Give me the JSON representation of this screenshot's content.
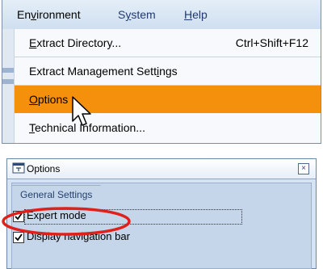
{
  "menubar": {
    "items": [
      {
        "pre": "En",
        "u": "v",
        "post": "ironment"
      },
      {
        "pre": "S",
        "u": "y",
        "post": "stem"
      },
      {
        "pre": "",
        "u": "H",
        "post": "elp"
      }
    ]
  },
  "dropdown": {
    "items": [
      {
        "pre": "",
        "u": "E",
        "post": "xtract Directory...",
        "accel": "Ctrl+Shift+F12"
      },
      {
        "pre": "Extract Management Sett",
        "u": "i",
        "post": "ngs",
        "accel": ""
      },
      {
        "pre": "",
        "u": "O",
        "post": "ptions",
        "accel": ""
      },
      {
        "pre": "",
        "u": "T",
        "post": "echnical Information...",
        "accel": ""
      }
    ],
    "active_index": 2,
    "highlight_color": "#f4900c"
  },
  "dialog": {
    "title": "Options",
    "close_glyph": "×",
    "tab_label": "General Settings",
    "checkboxes": [
      {
        "label": "Expert mode",
        "checked": true
      },
      {
        "label": "Display navigation bar",
        "checked": true
      }
    ],
    "annotation_color": "#e0201b"
  }
}
